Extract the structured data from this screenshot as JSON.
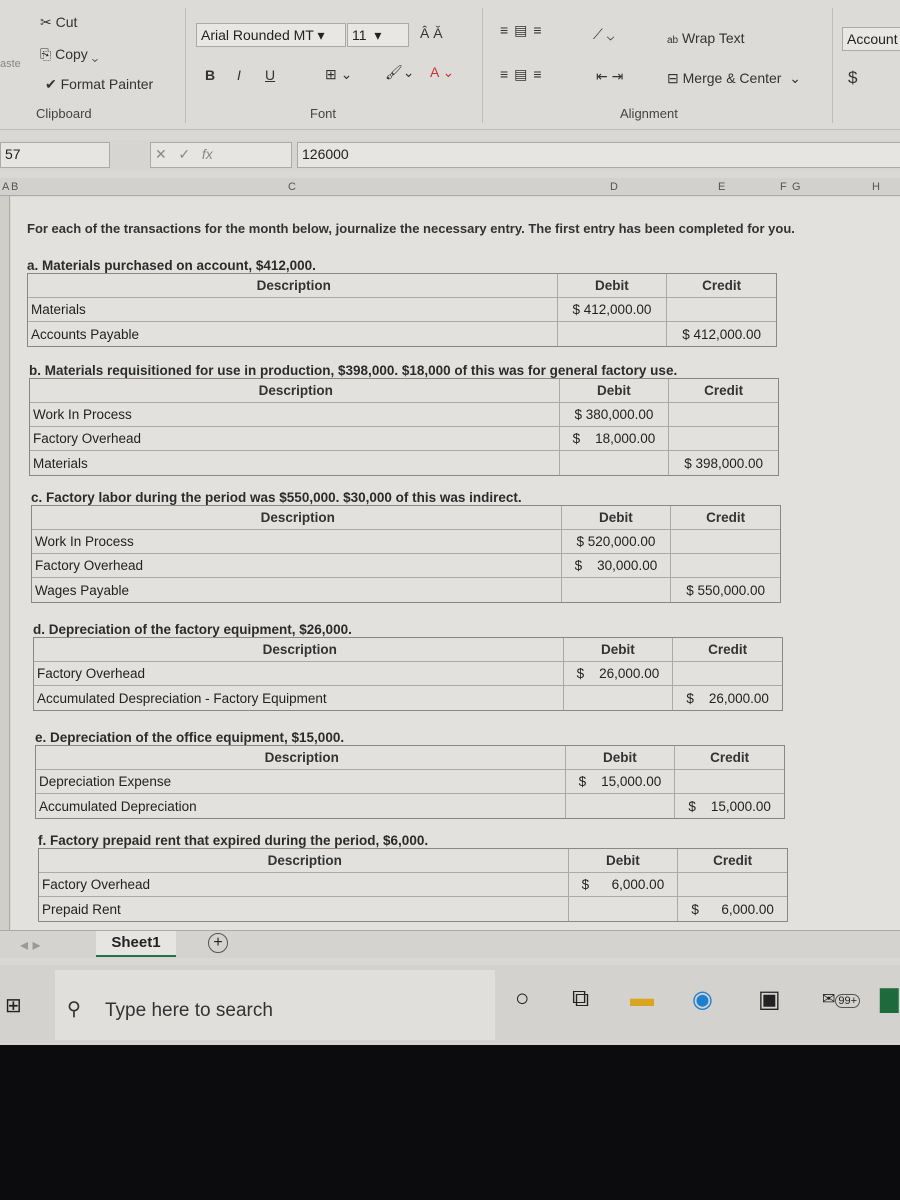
{
  "ribbon": {
    "clipboard": {
      "cut": "Cut",
      "copy": "Copy",
      "format_painter": "Format Painter",
      "label": "Clipboard",
      "paste": "aste"
    },
    "font": {
      "name": "Arial Rounded MT",
      "size": "11",
      "label": "Font",
      "bold": "B",
      "italic": "I",
      "underline": "U"
    },
    "alignment": {
      "wrap_text": "Wrap Text",
      "merge_center": "Merge & Center",
      "label": "Alignment"
    },
    "number": {
      "format": "Account",
      "currency": "$"
    }
  },
  "formula_bar": {
    "cell_ref": "57",
    "fx": "fx",
    "value": "126000"
  },
  "columns": [
    "A",
    "B",
    "C",
    "D",
    "E",
    "F",
    "G",
    "H"
  ],
  "sheet": {
    "intro": "For each of the transactions for the month below, journalize the necessary entry. The first entry has been completed for you.",
    "headers": {
      "description": "Description",
      "debit": "Debit",
      "credit": "Credit"
    },
    "sections": [
      {
        "title": "a. Materials purchased on account, $412,000.",
        "rows": [
          {
            "account": "Materials",
            "debit": "$ 412,000.00",
            "credit": ""
          },
          {
            "account": "Accounts Payable",
            "debit": "",
            "credit": "$ 412,000.00"
          }
        ]
      },
      {
        "title": "b. Materials requisitioned for use in production, $398,000. $18,000 of this was for general factory use.",
        "rows": [
          {
            "account": "Work In Process",
            "debit": "$ 380,000.00",
            "credit": ""
          },
          {
            "account": "Factory Overhead",
            "debit": "$    18,000.00",
            "credit": ""
          },
          {
            "account": "Materials",
            "debit": "",
            "credit": "$ 398,000.00"
          }
        ]
      },
      {
        "title": "c. Factory labor during the period was $550,000. $30,000 of this was indirect.",
        "rows": [
          {
            "account": "Work In Process",
            "debit": "$ 520,000.00",
            "credit": ""
          },
          {
            "account": "Factory Overhead",
            "debit": "$    30,000.00",
            "credit": ""
          },
          {
            "account": "Wages Payable",
            "debit": "",
            "credit": "$ 550,000.00"
          }
        ]
      },
      {
        "title": "d. Depreciation of the factory equipment, $26,000.",
        "rows": [
          {
            "account": "Factory Overhead",
            "debit": "$    26,000.00",
            "credit": ""
          },
          {
            "account": "Accumulated Despreciation - Factory Equipment",
            "debit": "",
            "credit": "$    26,000.00"
          }
        ]
      },
      {
        "title": "e. Depreciation of the office equipment, $15,000.",
        "rows": [
          {
            "account": "Depreciation Expense",
            "debit": "$    15,000.00",
            "credit": ""
          },
          {
            "account": "Accumulated Depreciation",
            "debit": "",
            "credit": "$    15,000.00"
          }
        ]
      },
      {
        "title": "f. Factory prepaid rent that expired during the period, $6,000.",
        "rows": [
          {
            "account": "Factory Overhead",
            "debit": "$      6,000.00",
            "credit": ""
          },
          {
            "account": "Prepaid Rent",
            "debit": "",
            "credit": "$      6,000.00"
          }
        ]
      }
    ]
  },
  "sheet_tabs": {
    "active": "Sheet1",
    "add": "+"
  },
  "taskbar": {
    "search_placeholder": "Type here to search",
    "mail_badge": "99+"
  }
}
